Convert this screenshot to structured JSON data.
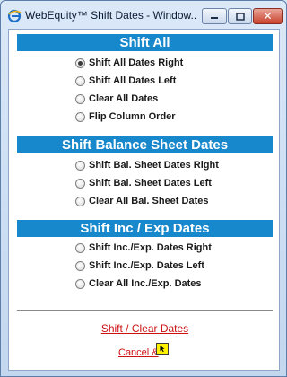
{
  "window": {
    "title": "WebEquity™ Shift Dates - Window...",
    "controls": {
      "minimize": "▁",
      "maximize": "▢",
      "close": "✕"
    }
  },
  "sections": [
    {
      "header": "Shift All",
      "options": [
        {
          "label": "Shift All Dates Right",
          "checked": true
        },
        {
          "label": "Shift All Dates Left",
          "checked": false
        },
        {
          "label": "Clear All Dates",
          "checked": false
        },
        {
          "label": "Flip Column Order",
          "checked": false
        }
      ]
    },
    {
      "header": "Shift Balance Sheet Dates",
      "options": [
        {
          "label": "Shift Bal. Sheet Dates Right",
          "checked": false
        },
        {
          "label": "Shift Bal. Sheet Dates Left",
          "checked": false
        },
        {
          "label": "Clear All Bal. Sheet Dates",
          "checked": false
        }
      ]
    },
    {
      "header": "Shift Inc / Exp Dates",
      "options": [
        {
          "label": "Shift Inc./Exp. Dates Right",
          "checked": false
        },
        {
          "label": "Shift Inc./Exp. Dates Left",
          "checked": false
        },
        {
          "label": "Clear All Inc./Exp. Dates",
          "checked": false
        }
      ]
    }
  ],
  "actions": {
    "shift_clear_label": "Shift / Clear Dates",
    "cancel_label": "Cancel &"
  },
  "colors": {
    "section_header_bg": "#1888cc",
    "link": "#cc1111"
  },
  "icons": {
    "app": "ie-globe-icon",
    "cursor": "yellow-box-cursor-icon"
  }
}
